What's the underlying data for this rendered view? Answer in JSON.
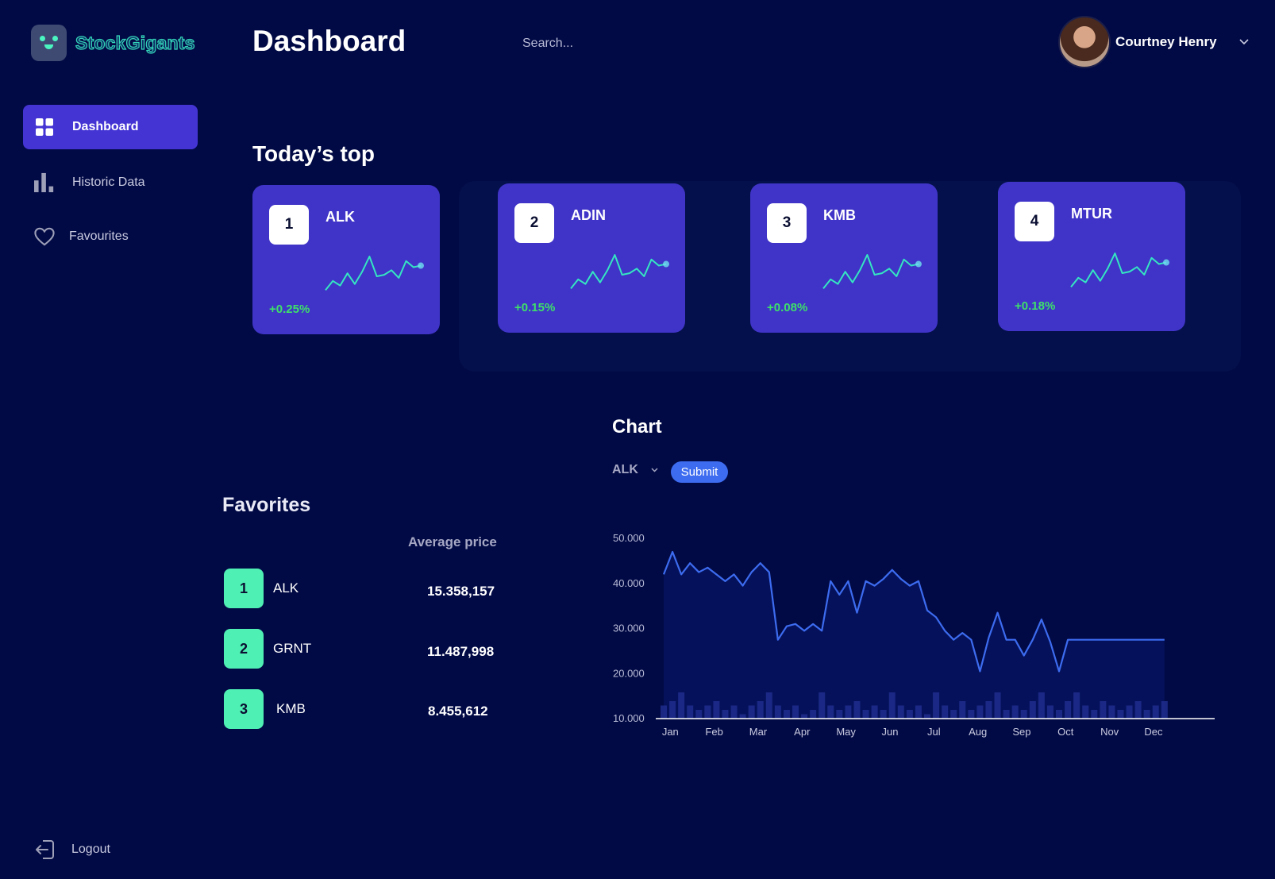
{
  "app": {
    "logo_text": "StockGigants"
  },
  "sidebar": {
    "items": [
      {
        "label": "Dashboard",
        "icon": "grid-icon"
      },
      {
        "label": "Historic Data",
        "icon": "bar-chart-icon"
      },
      {
        "label": "Favourites",
        "icon": "heart-icon"
      }
    ],
    "logout_label": "Logout"
  },
  "header": {
    "title": "Dashboard",
    "search_placeholder": "Search...",
    "user_name": "Courtney Henry"
  },
  "top": {
    "title": "Today’s top",
    "cards": [
      {
        "rank": "1",
        "ticker": "ALK",
        "change": "+0.25%"
      },
      {
        "rank": "2",
        "ticker": "ADIN",
        "change": "+0.15%"
      },
      {
        "rank": "3",
        "ticker": "KMB",
        "change": "+0.08%"
      },
      {
        "rank": "4",
        "ticker": "MTUR",
        "change": "+0.18%"
      }
    ]
  },
  "favorites": {
    "title": "Favorites",
    "column_header": "Average price",
    "rows": [
      {
        "rank": "1",
        "ticker": "ALK",
        "price": "15.358,157"
      },
      {
        "rank": "2",
        "ticker": "GRNT",
        "price": "11.487,998"
      },
      {
        "rank": "3",
        "ticker": "KMB",
        "price": "8.455,612"
      }
    ]
  },
  "chart": {
    "title": "Chart",
    "selected": "ALK",
    "submit_label": "Submit"
  },
  "colors": {
    "background": "#020a45",
    "accent": "#4434d4",
    "card": "#3f34c7",
    "line": "#3d6cf0",
    "positive": "#3ee06a",
    "favorite_badge": "#4ff0b4",
    "sparkline": "#35e6c2"
  },
  "chart_data": {
    "type": "line",
    "categories": [
      "Jan",
      "Feb",
      "Mar",
      "Apr",
      "May",
      "Jun",
      "Jul",
      "Aug",
      "Sep",
      "Oct",
      "Nov",
      "Dec"
    ],
    "y_ticks": [
      "10.000",
      "20.000",
      "30.000",
      "40.000",
      "50.000"
    ],
    "ylim": [
      10000,
      50000
    ],
    "grid": false,
    "x": [
      0,
      0.2,
      0.4,
      0.6,
      0.8,
      1.0,
      1.2,
      1.4,
      1.6,
      1.8,
      2.0,
      2.2,
      2.4,
      2.6,
      2.8,
      3.0,
      3.2,
      3.4,
      3.6,
      3.8,
      4.0,
      4.2,
      4.4,
      4.6,
      4.8,
      5.0,
      5.2,
      5.4,
      5.6,
      5.8,
      6.0,
      6.2,
      6.4,
      6.6,
      6.8,
      7.0,
      7.2,
      7.4,
      7.6,
      7.8,
      8.0,
      8.2,
      8.4,
      8.6,
      8.8,
      9.0,
      9.2,
      9.4,
      9.6,
      9.8,
      10.0,
      10.2,
      10.4,
      10.6,
      10.8,
      11.0,
      11.2,
      11.4
    ],
    "values": [
      42000,
      47000,
      42000,
      44500,
      42500,
      43500,
      42000,
      40500,
      42000,
      39500,
      42500,
      44500,
      42500,
      27500,
      30500,
      31000,
      29500,
      31000,
      29500,
      40500,
      37500,
      40500,
      33500,
      40500,
      39500,
      41000,
      43000,
      41000,
      39500,
      40500,
      34000,
      32500,
      29500,
      27500,
      29000,
      27500,
      20500,
      28000,
      33500,
      27500,
      27500,
      24000,
      27500,
      32000,
      27000,
      20500,
      27500,
      27500,
      27500,
      27500,
      27500,
      27500,
      27500,
      27500,
      27500,
      27500,
      27500,
      27500
    ],
    "volume": [
      3,
      4,
      6,
      3,
      2,
      3,
      4,
      2,
      3,
      1,
      3,
      4,
      6,
      3,
      2,
      3,
      1,
      2,
      6,
      3,
      2,
      3,
      4,
      2,
      3,
      2,
      6,
      3,
      2,
      3,
      1,
      6,
      3,
      2,
      4,
      2,
      3,
      4,
      6,
      2,
      3,
      2,
      4,
      6,
      3,
      2,
      4,
      6,
      3,
      2,
      4,
      3,
      2,
      3,
      4,
      2,
      3,
      4
    ]
  },
  "sparkline": [
    5,
    11,
    8,
    16,
    9,
    17,
    27,
    14,
    15,
    18,
    13,
    24,
    20,
    21
  ]
}
